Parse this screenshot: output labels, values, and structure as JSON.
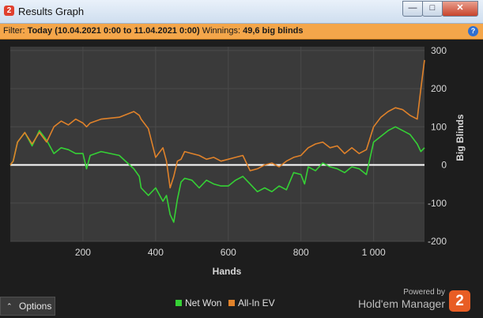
{
  "window": {
    "title": "Results Graph",
    "app_badge": "2"
  },
  "window_controls": {
    "minimize": "—",
    "maximize": "□",
    "close": "✕"
  },
  "filter": {
    "prefix": "Filter:",
    "value": "Today (10.04.2021 0:00 to 11.04.2021 0:00)",
    "winnings_label": "Winnings:",
    "winnings_value": "49,6 big blinds",
    "help": "?"
  },
  "footer": {
    "options_label": "Options",
    "powered_by": "Powered by",
    "brand": "Hold'em Manager",
    "brand_badge": "2"
  },
  "colors": {
    "net_won": "#35d135",
    "all_in_ev": "#e0822a",
    "zero_line": "#ffffff",
    "plot_bg": "#3a3a3a",
    "grid": "#4a4a4a"
  },
  "chart_data": {
    "type": "line",
    "xlabel": "Hands",
    "ylabel": "Big Blinds",
    "xlim": [
      0,
      1140
    ],
    "ylim": [
      -200,
      310
    ],
    "x_ticks": [
      200,
      400,
      600,
      800,
      1000
    ],
    "x_tick_labels": [
      "200",
      "400",
      "600",
      "800",
      "1 000"
    ],
    "y_ticks": [
      -200,
      -100,
      0,
      100,
      200,
      300
    ],
    "grid": true,
    "series": [
      {
        "name": "Net Won",
        "x": [
          0,
          8,
          20,
          40,
          60,
          80,
          100,
          120,
          140,
          160,
          180,
          200,
          210,
          220,
          250,
          300,
          340,
          355,
          360,
          380,
          400,
          420,
          430,
          440,
          450,
          460,
          470,
          480,
          500,
          520,
          540,
          560,
          580,
          600,
          620,
          640,
          660,
          680,
          700,
          720,
          740,
          760,
          780,
          800,
          810,
          820,
          840,
          860,
          880,
          900,
          920,
          940,
          960,
          980,
          1000,
          1020,
          1040,
          1060,
          1080,
          1100,
          1120,
          1130,
          1140
        ],
        "y": [
          0,
          10,
          60,
          85,
          50,
          90,
          65,
          30,
          45,
          40,
          30,
          30,
          -10,
          25,
          35,
          25,
          -10,
          -30,
          -60,
          -80,
          -60,
          -95,
          -80,
          -130,
          -150,
          -90,
          -45,
          -35,
          -40,
          -60,
          -40,
          -50,
          -55,
          -55,
          -40,
          -30,
          -50,
          -70,
          -60,
          -70,
          -55,
          -65,
          -20,
          -25,
          -50,
          -5,
          -15,
          5,
          -5,
          -10,
          -20,
          -5,
          -10,
          -25,
          60,
          75,
          90,
          100,
          90,
          80,
          55,
          35,
          45
        ]
      },
      {
        "name": "All-In EV",
        "x": [
          0,
          8,
          20,
          40,
          60,
          80,
          100,
          120,
          140,
          160,
          180,
          200,
          210,
          220,
          250,
          300,
          340,
          355,
          360,
          380,
          400,
          420,
          430,
          440,
          450,
          460,
          470,
          480,
          500,
          520,
          540,
          560,
          580,
          600,
          620,
          640,
          660,
          680,
          700,
          720,
          740,
          760,
          780,
          800,
          810,
          820,
          840,
          860,
          880,
          900,
          920,
          940,
          960,
          980,
          1000,
          1020,
          1040,
          1060,
          1080,
          1100,
          1120,
          1130,
          1140
        ],
        "y": [
          0,
          10,
          60,
          85,
          55,
          85,
          60,
          100,
          115,
          105,
          120,
          110,
          100,
          110,
          120,
          125,
          140,
          130,
          120,
          95,
          20,
          45,
          10,
          -60,
          -30,
          10,
          15,
          35,
          30,
          25,
          15,
          20,
          10,
          15,
          20,
          25,
          -15,
          -10,
          0,
          5,
          -5,
          10,
          20,
          25,
          35,
          45,
          55,
          60,
          45,
          50,
          30,
          45,
          30,
          40,
          100,
          125,
          140,
          150,
          145,
          130,
          120,
          200,
          275
        ]
      }
    ]
  }
}
